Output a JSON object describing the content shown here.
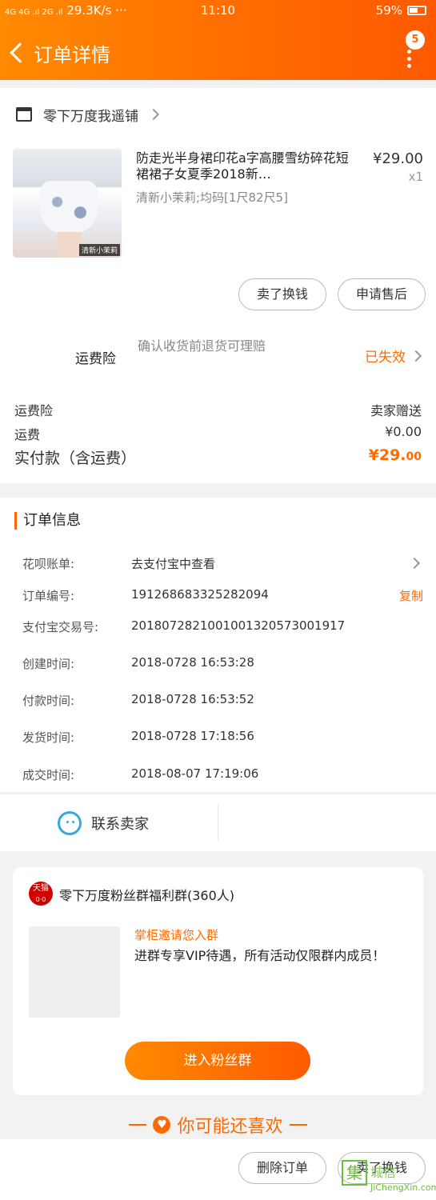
{
  "status_bar": {
    "network": "4G 4G .ıl 2G .ıl",
    "speed": "29.3K/s ···",
    "time": "11:10",
    "battery": "59%"
  },
  "header": {
    "title": "订单详情",
    "badge": "5",
    "back_icon": "chevron-left-icon",
    "more_icon": "more-vertical-icon"
  },
  "shop": {
    "name": "零下万度我遥铺"
  },
  "product": {
    "title": "防走光半身裙印花a字高腰雪纺碎花短裙裙子女夏季2018新…",
    "sku": "清新小茉莉;均码[1尺82尺5]",
    "price": "¥29.00",
    "qty": "x1",
    "image_tag": "清新小茉莉"
  },
  "actions": {
    "sell_label": "卖了换钱",
    "after_sale_label": "申请售后"
  },
  "insurance": {
    "label": "运费险",
    "desc": "确认收货前退货可理赔",
    "status": "已失效"
  },
  "summary": {
    "ins_label": "运费险",
    "ins_value": "卖家赠送",
    "shipping_label": "运费",
    "shipping_value": "¥0.00",
    "paid_label": "实付款（含运费）",
    "paid_value": "¥29.",
    "paid_cents": "00"
  },
  "order_info": {
    "title": "订单信息",
    "huabei_label": "花呗账单:",
    "huabei_value": "去支付宝中查看",
    "order_no_label": "订单编号:",
    "order_no": "191268683325282094",
    "copy_label": "复制",
    "alipay_label": "支付宝交易号:",
    "alipay_no": "2018072821001001320573001917",
    "created_label": "创建时间:",
    "created": "2018-0728 16:53:28",
    "paid_label": "付款时间:",
    "paid": "2018-0728 16:53:52",
    "shipped_label": "发货时间:",
    "shipped": "2018-0728 17:18:56",
    "done_label": "成交时间:",
    "done": "2018-08-07 17:19:06"
  },
  "contact": {
    "label": "联系卖家"
  },
  "group": {
    "brand": "天猫",
    "brand_sub": "0·0",
    "name": "零下万度粉丝群福利群(360人)",
    "subtitle": "掌柜邀请您入群",
    "desc": "进群专享VIP待遇，所有活动仅限群内成员！",
    "join_label": "进入粉丝群"
  },
  "recommend": {
    "label": "你可能还喜欢"
  },
  "bottom": {
    "delete_label": "删除订单",
    "sell_label": "卖了换钱"
  },
  "watermark": {
    "char": "集",
    "name": "城信",
    "url": "JiChengXin.com"
  },
  "colors": {
    "accent": "#ff6a00",
    "chat": "#3aa6e8"
  }
}
